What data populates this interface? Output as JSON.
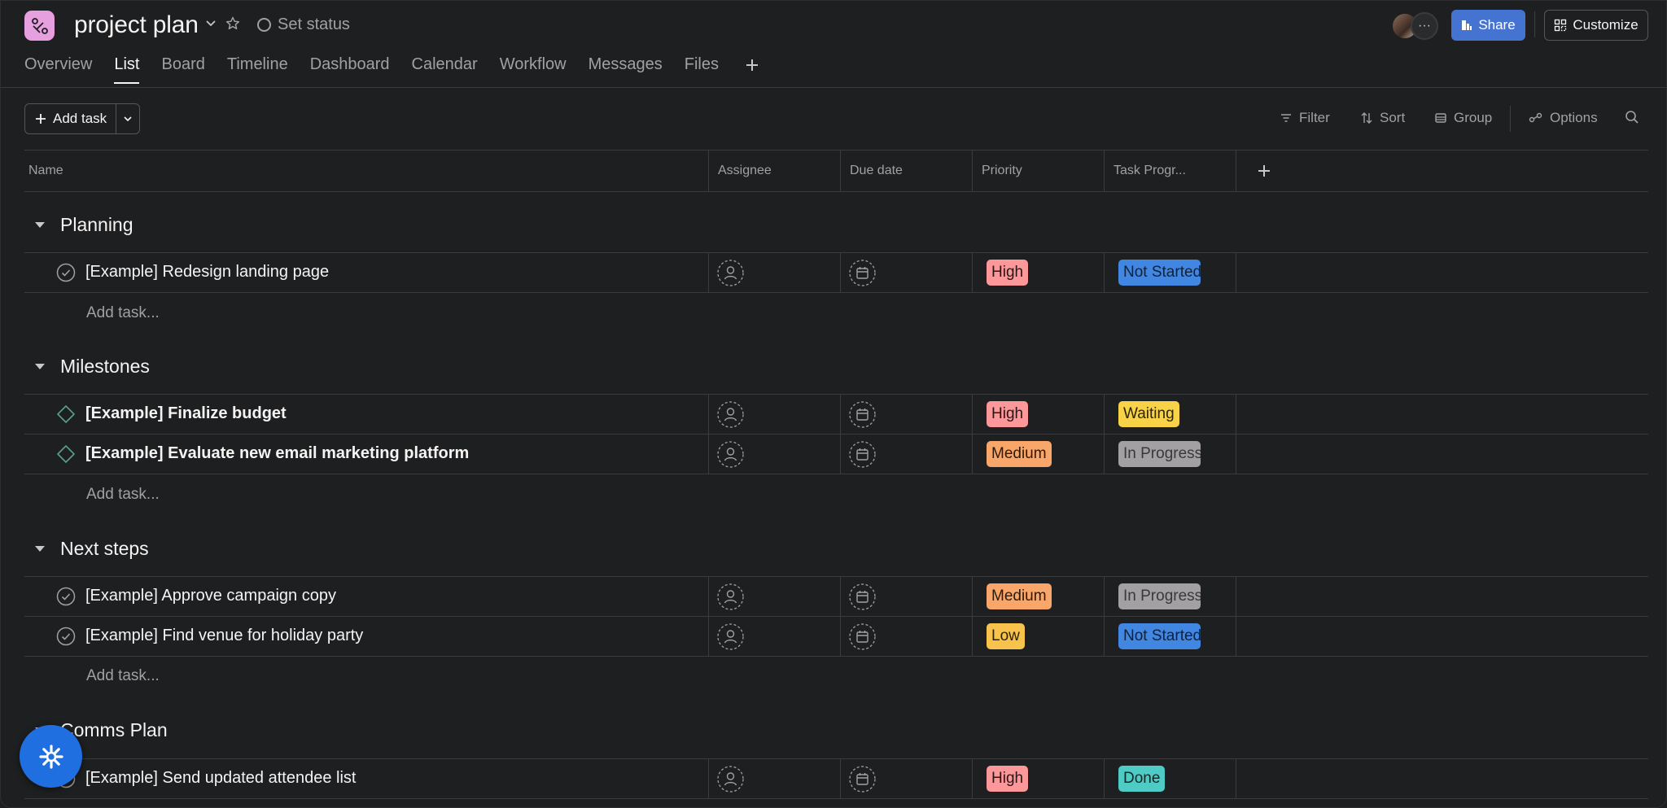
{
  "project": {
    "title": "project plan",
    "set_status": "Set status",
    "app_icon": "project-icon"
  },
  "header": {
    "avatar_more": "···",
    "share_label": "Share",
    "customize_label": "Customize"
  },
  "tabs": [
    {
      "label": "Overview"
    },
    {
      "label": "List"
    },
    {
      "label": "Board"
    },
    {
      "label": "Timeline"
    },
    {
      "label": "Dashboard"
    },
    {
      "label": "Calendar"
    },
    {
      "label": "Workflow"
    },
    {
      "label": "Messages"
    },
    {
      "label": "Files"
    }
  ],
  "active_tab": "List",
  "toolbar": {
    "add_task": "Add task",
    "filter": "Filter",
    "sort": "Sort",
    "group": "Group",
    "options": "Options"
  },
  "columns": {
    "name": "Name",
    "assignee": "Assignee",
    "due_date": "Due date",
    "priority": "Priority",
    "task_progress": "Task Progr..."
  },
  "add_task_placeholder": "Add task...",
  "sections": [
    {
      "title": "Planning",
      "tasks": [
        {
          "name": "[Example] Redesign landing page",
          "kind": "task",
          "priority": "High",
          "progress": "Not Started"
        }
      ]
    },
    {
      "title": "Milestones",
      "tasks": [
        {
          "name": "[Example] Finalize budget",
          "kind": "milestone",
          "priority": "High",
          "progress": "Waiting"
        },
        {
          "name": "[Example] Evaluate new email marketing platform",
          "kind": "milestone",
          "priority": "Medium",
          "progress": "In Progress"
        }
      ]
    },
    {
      "title": "Next steps",
      "tasks": [
        {
          "name": "[Example] Approve campaign copy",
          "kind": "task",
          "priority": "Medium",
          "progress": "In Progress"
        },
        {
          "name": "[Example] Find venue for holiday party",
          "kind": "task",
          "priority": "Low",
          "progress": "Not Started"
        }
      ]
    },
    {
      "title": "Comms Plan",
      "tasks": [
        {
          "name": "[Example] Send updated attendee list",
          "kind": "task",
          "priority": "High",
          "progress": "Done"
        }
      ]
    }
  ],
  "colors": {
    "high": "#fc979a",
    "medium": "#f8a66a",
    "low": "#f8c34d",
    "not_started": "#4186e0",
    "waiting": "#f8d347",
    "in_progress": "#a2a0a2",
    "done": "#4ecbc4",
    "share": "#4573d2",
    "fab": "#1f6fe0"
  }
}
